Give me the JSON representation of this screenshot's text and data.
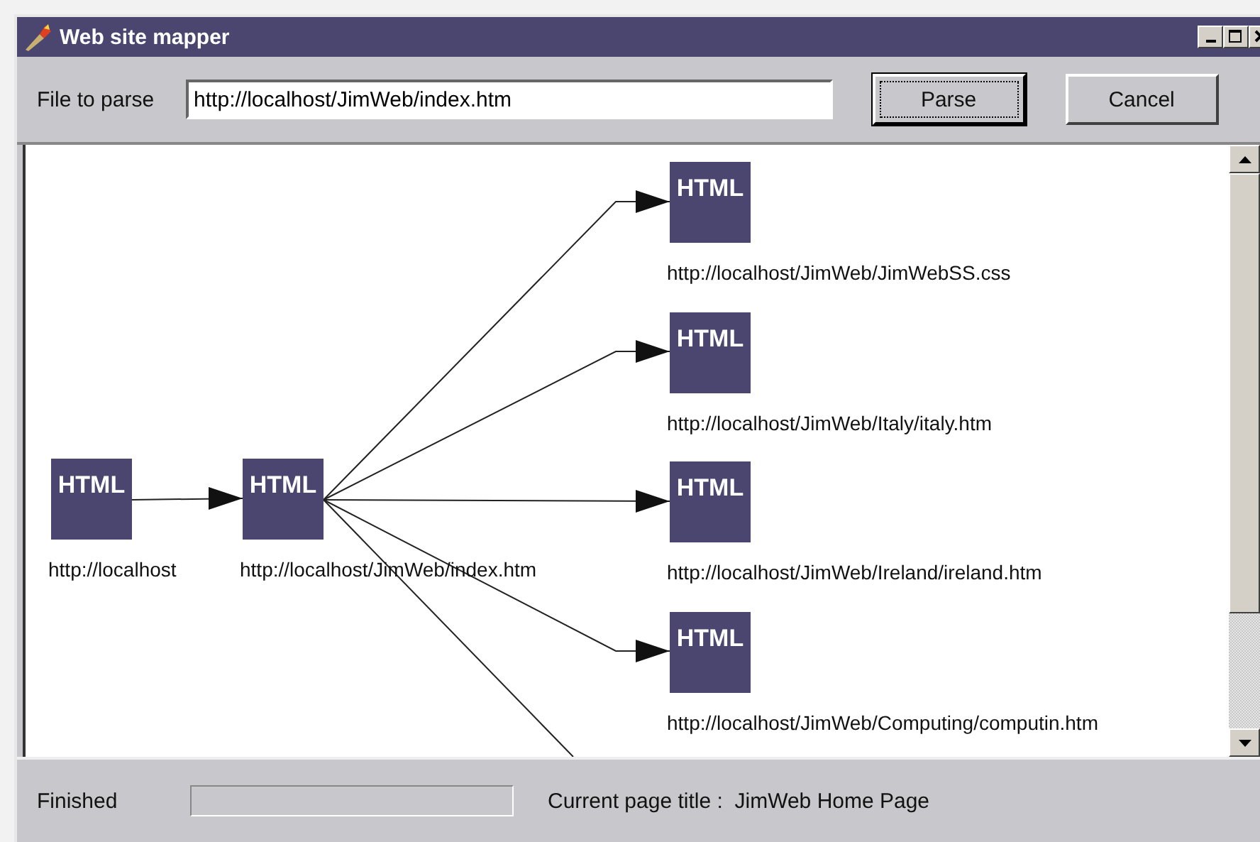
{
  "window": {
    "title": "Web site mapper"
  },
  "toolbar": {
    "label": "File to parse",
    "field_value": "http://localhost/JimWeb/index.htm",
    "buttons": [
      {
        "label": "Parse",
        "focused": true
      },
      {
        "label": "Cancel",
        "focused": false
      }
    ]
  },
  "site_map": {
    "nodes": [
      {
        "icon_text": "HTML",
        "label": "http://localhost",
        "children": [
          {
            "icon_text": "HTML",
            "label": "http://localhost/JimWeb/index.htm",
            "more_children_below": true,
            "children": [
              {
                "icon_text": "HTML",
                "label": "http://localhost/JimWeb/JimWebSS.css"
              },
              {
                "icon_text": "HTML",
                "label": "http://localhost/JimWeb/Italy/italy.htm"
              },
              {
                "icon_text": "HTML",
                "label": "http://localhost/JimWeb/Ireland/ireland.htm"
              },
              {
                "icon_text": "HTML",
                "label": "http://localhost/JimWeb/Computing/computin.htm"
              }
            ]
          }
        ]
      }
    ]
  },
  "status_bar": {
    "status": "Finished",
    "progress": {
      "level": 0
    },
    "page_title_label": "Current page title :",
    "page_title": "JimWeb Home Page"
  }
}
